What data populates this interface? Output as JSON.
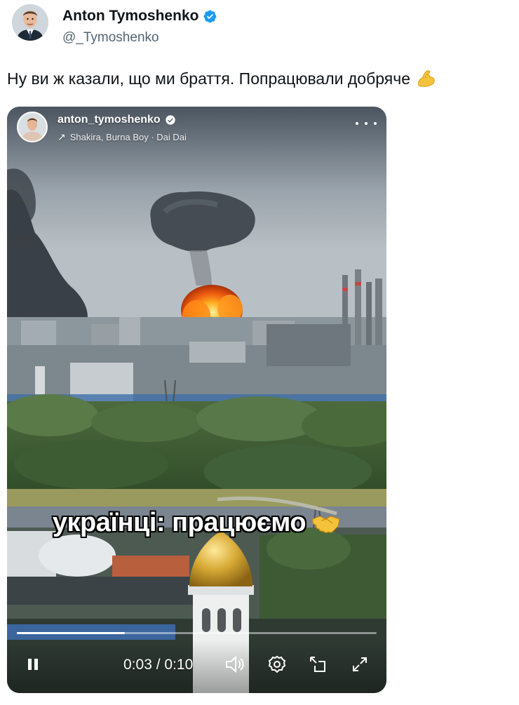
{
  "tweet": {
    "author_name": "Anton Tymoshenko",
    "author_handle": "@_Tymoshenko",
    "text": "Ну ви ж казали, що ми браття. Попрацювали добряче",
    "text_emoji_icon": "flexed-biceps-icon"
  },
  "video": {
    "ig_username": "anton_tymoshenko",
    "ig_music": "Shakira, Burna Boy · Dai Dai",
    "caption": "українці: працюємо",
    "caption_emoji_icon": "handshake-icon",
    "time_display": "0:03 / 0:10",
    "progress": 0.3
  },
  "colors": {
    "verified": "#1d9bf0",
    "handle": "#536471",
    "text": "#0f1419"
  }
}
